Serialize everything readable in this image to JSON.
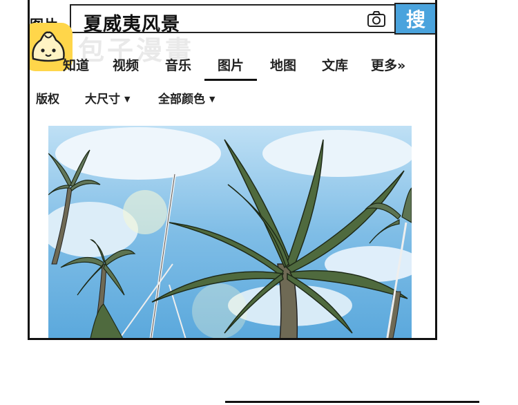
{
  "search": {
    "section_label": "图片",
    "query": "夏威夷风景",
    "button_label": "搜"
  },
  "watermark": "包子漫畫",
  "tabs": [
    {
      "label": "知道"
    },
    {
      "label": "视频"
    },
    {
      "label": "音乐"
    },
    {
      "label": "图片",
      "active": true
    },
    {
      "label": "地图"
    },
    {
      "label": "文库"
    },
    {
      "label": "更多»"
    }
  ],
  "filters": [
    {
      "label": "版权"
    },
    {
      "label": "大尺寸",
      "has_dropdown": true
    },
    {
      "label": "全部颜色",
      "has_dropdown": true
    }
  ],
  "icons": {
    "camera": "camera-icon",
    "logo": "baozi-logo-icon"
  },
  "colors": {
    "search_button": "#4aa3dd",
    "logo": "#ffd64a"
  }
}
